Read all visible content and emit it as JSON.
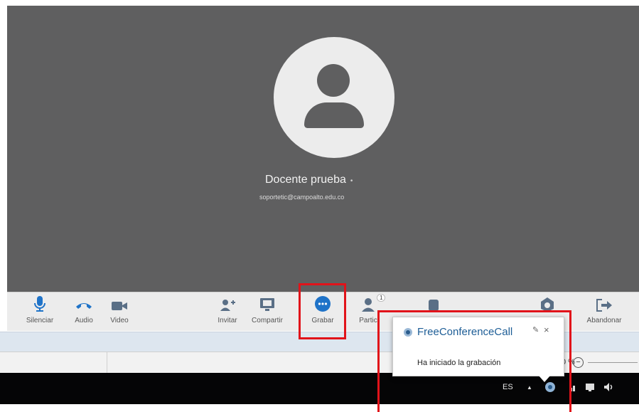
{
  "participant": {
    "name": "Docente prueba",
    "status_dot": "•",
    "email": "soportetic@campoalto.edu.co"
  },
  "toolbar": {
    "items": [
      {
        "label": "Silenciar",
        "icon": "microphone-icon"
      },
      {
        "label": "Audio",
        "icon": "phone-icon"
      },
      {
        "label": "Video",
        "icon": "video-camera-icon"
      },
      {
        "label": "Invitar",
        "icon": "add-person-icon"
      },
      {
        "label": "Compartir",
        "icon": "share-screen-icon"
      },
      {
        "label": "Grabar",
        "icon": "record-icon"
      },
      {
        "label": "Partic",
        "icon": "participants-icon",
        "badge": "1"
      },
      {
        "label": "Abandonar",
        "icon": "leave-icon"
      }
    ]
  },
  "notification": {
    "app": "FreeConferenceCall",
    "pin": "✎",
    "close": "×",
    "message": "Ha iniciado la grabación"
  },
  "zoom": {
    "text": "0 %",
    "minus": "−"
  },
  "taskbar": {
    "language": "ES",
    "caret": "▲"
  },
  "colors": {
    "highlight": "#e1131a",
    "accent_blue": "#1f73c8",
    "toolbar_bg": "#ececec",
    "stage_bg": "#5f5f60"
  }
}
